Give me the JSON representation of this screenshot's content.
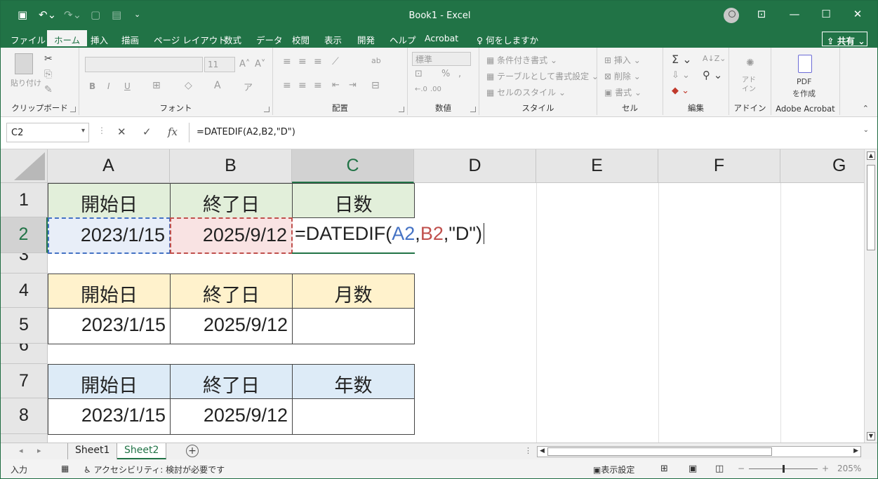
{
  "window": {
    "title": "Book1  -  Excel"
  },
  "tabs": [
    "ファイル",
    "ホーム",
    "挿入",
    "描画",
    "ページ レイアウト",
    "数式",
    "データ",
    "校閲",
    "表示",
    "開発",
    "ヘルプ",
    "Acrobat"
  ],
  "active_tab": "ホーム",
  "search_label": "何をしますか",
  "share_label": "共有",
  "ribbon": {
    "clipboard": {
      "paste": "貼り付け",
      "label": "クリップボード"
    },
    "font": {
      "size": "11",
      "bold": "B",
      "italic": "I",
      "underline": "U",
      "label": "フォント"
    },
    "alignment": {
      "label": "配置"
    },
    "number": {
      "format": "標準",
      "percent": "%",
      "label": "数値"
    },
    "styles": {
      "conditional": "条件付き書式",
      "table": "テーブルとして書式設定",
      "cell_styles": "セルのスタイル",
      "label": "スタイル"
    },
    "cells": {
      "insert": "挿入",
      "delete": "削除",
      "format": "書式",
      "label": "セル"
    },
    "editing": {
      "label": "編集"
    },
    "addins": {
      "text": "アド\nイン",
      "label": "アドイン"
    },
    "acrobat": {
      "pdf": "PDF",
      "create": "を作成",
      "label": "Adobe Acrobat"
    }
  },
  "formula_bar": {
    "name_box": "C2",
    "formula": "=DATEDIF(A2,B2,\"D\")"
  },
  "columns": [
    "A",
    "B",
    "C",
    "D",
    "E",
    "F",
    "G"
  ],
  "rows": [
    "1",
    "2",
    "3",
    "4",
    "5",
    "6",
    "7",
    "8"
  ],
  "cells": {
    "A1": "開始日",
    "B1": "終了日",
    "C1": "日数",
    "A2": "2023/1/15",
    "B2": "2025/9/12",
    "A4": "開始日",
    "B4": "終了日",
    "C4": "月数",
    "A5": "2023/1/15",
    "B5": "2025/9/12",
    "A7": "開始日",
    "B7": "終了日",
    "C7": "年数",
    "A8": "2023/1/15",
    "B8": "2025/9/12"
  },
  "edit_formula": {
    "prefix": "=DATEDIF(",
    "ref1": "A2",
    "comma": ",",
    "ref2": "B2",
    "suffix": ",\"D\")"
  },
  "sheets": [
    "Sheet1",
    "Sheet2"
  ],
  "active_sheet": "Sheet2",
  "status": {
    "mode": "入力",
    "accessibility": "アクセシビリティ: 検討が必要です",
    "display_settings": "表示設定",
    "zoom": "205%"
  },
  "colors": {
    "excel_green": "#217346",
    "header_green": "#e2efda",
    "header_orange": "#fff2cc",
    "header_blue": "#ddebf7",
    "ref_blue": "#4472c4",
    "ref_red": "#c0504d"
  }
}
